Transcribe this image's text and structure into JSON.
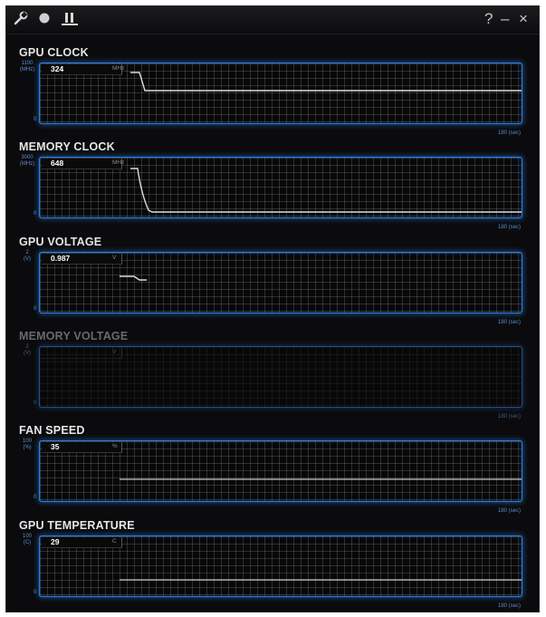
{
  "window": {
    "toolbar": {
      "settings_icon": "wrench-icon",
      "record_icon": "circle-icon",
      "pause_icon": "pause-icon"
    },
    "controls": {
      "help_label": "?",
      "minimize_label": "–",
      "close_label": "×"
    }
  },
  "colors": {
    "background": "#0b0b0d",
    "frame_glow": "#2f7fd8",
    "grid": "#3a3a3a",
    "trace": "#d8d8d8"
  },
  "panels": [
    {
      "title": "GPU CLOCK",
      "value": "324",
      "unit": "MHz",
      "axis_max": "1100\n(MHz)",
      "axis_min": "0",
      "time_span": "180 (sec)",
      "enabled": true
    },
    {
      "title": "MEMORY CLOCK",
      "value": "648",
      "unit": "MHz",
      "axis_max": "3000\n(MHz)",
      "axis_min": "0",
      "time_span": "180 (sec)",
      "enabled": true
    },
    {
      "title": "GPU VOLTAGE",
      "value": "0.987",
      "unit": "V",
      "axis_max": "2\n(V)",
      "axis_min": "0",
      "time_span": "180 (sec)",
      "enabled": true
    },
    {
      "title": "MEMORY VOLTAGE",
      "value": "",
      "unit": "V",
      "axis_max": "2\n(V)",
      "axis_min": "0",
      "time_span": "180 (sec)",
      "enabled": false
    },
    {
      "title": "FAN SPEED",
      "value": "35",
      "unit": "%",
      "axis_max": "100\n(%)",
      "axis_min": "0",
      "time_span": "180 (sec)",
      "enabled": true
    },
    {
      "title": "GPU TEMPERATURE",
      "value": "29",
      "unit": "C",
      "axis_max": "100\n(C)",
      "axis_min": "0",
      "time_span": "180 (sec)",
      "enabled": true
    }
  ]
}
